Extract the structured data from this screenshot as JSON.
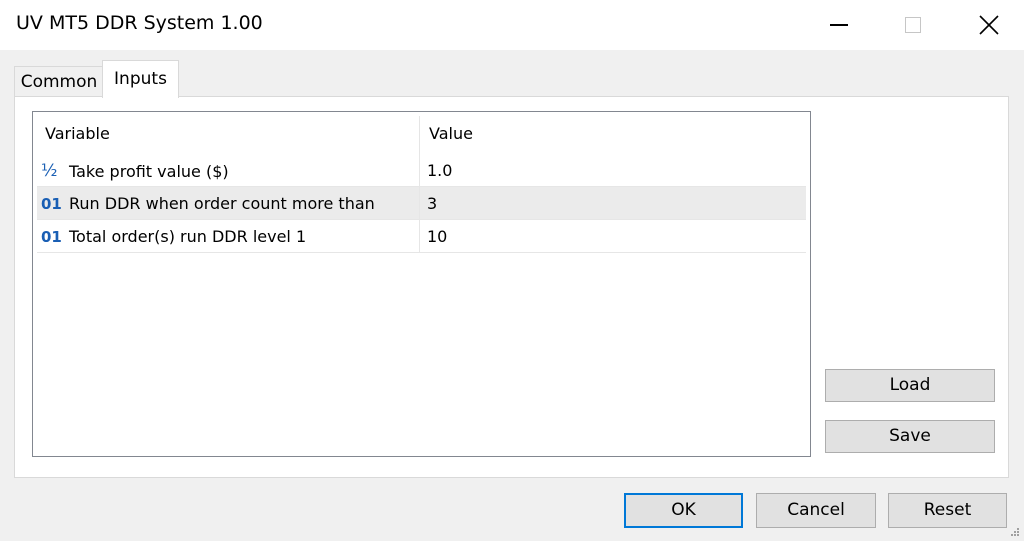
{
  "window": {
    "title": "UV MT5 DDR System 1.00"
  },
  "tabs": [
    {
      "label": "Common",
      "active": false
    },
    {
      "label": "Inputs",
      "active": true
    }
  ],
  "grid": {
    "columns": {
      "variable": "Variable",
      "value": "Value"
    },
    "rows": [
      {
        "type_icon": "½",
        "type": "double-icon",
        "variable": "Take profit value ($)",
        "value": "1.0",
        "selected": false
      },
      {
        "type_icon": "01",
        "type": "integer-icon",
        "variable": "Run DDR when order count more than",
        "value": "3",
        "selected": true
      },
      {
        "type_icon": "01",
        "type": "integer-icon",
        "variable": "Total order(s) run DDR level 1",
        "value": "10",
        "selected": false
      }
    ]
  },
  "side_buttons": {
    "load": "Load",
    "save": "Save"
  },
  "footer_buttons": {
    "ok": "OK",
    "cancel": "Cancel",
    "reset": "Reset"
  },
  "colors": {
    "accent": "#0078d7",
    "type_icon": "#1a5fb4",
    "selected_row": "#ebebeb"
  }
}
